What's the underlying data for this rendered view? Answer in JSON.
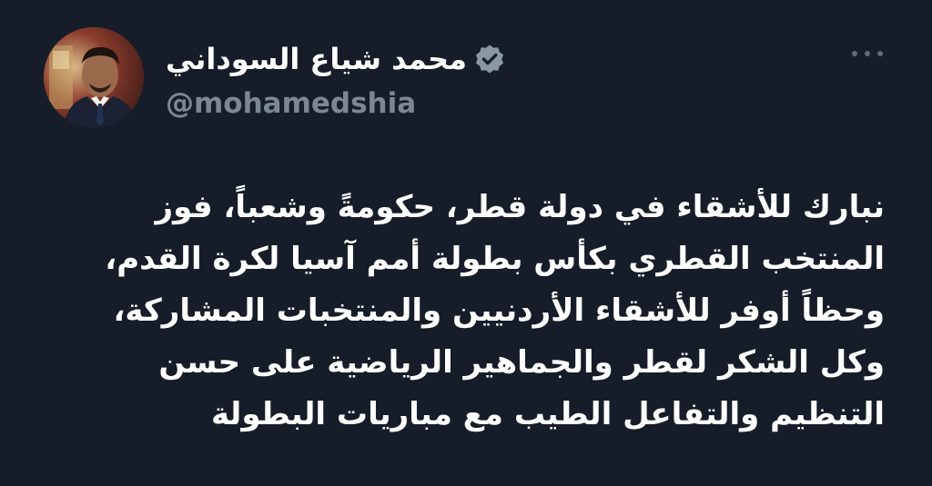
{
  "tweet": {
    "author": {
      "display_name": "محمد شياع السوداني",
      "handle": "@mohamedshia",
      "verified_icon": "verified-badge-icon",
      "avatar_icon": "profile-photo"
    },
    "more_icon": "more-options-icon",
    "text_lines": [
      "نبارك للأشقاء في دولة قطر، حكومةً وشعباً، فوز",
      "المنتخب القطري بكأس بطولة أمم آسيا لكرة القدم،",
      "وحظاً أوفر للأشقاء الأردنيين والمنتخبات المشاركة،",
      "وكل الشكر لقطر والجماهير الرياضية على حسن",
      "التنظيم والتفاعل الطيب مع مباريات البطولة"
    ]
  },
  "colors": {
    "background": "#161d28",
    "primary_text": "#ffffff",
    "secondary_text": "#7b8792",
    "verified_badge": "#8a97a5"
  }
}
